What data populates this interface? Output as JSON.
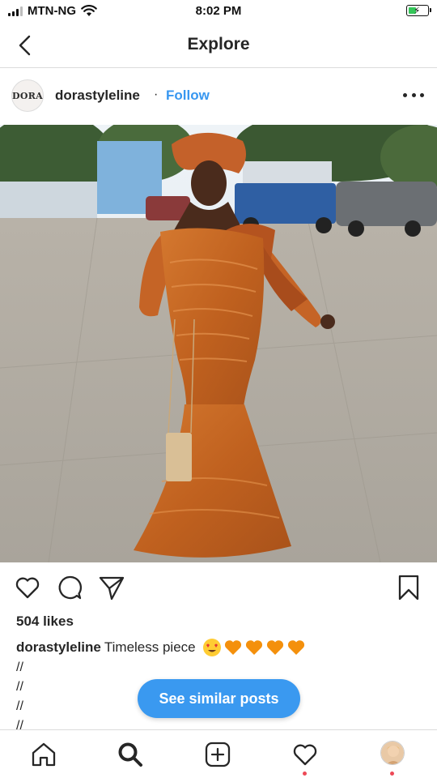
{
  "status_bar": {
    "carrier": "MTN-NG",
    "time": "8:02 PM"
  },
  "header": {
    "title": "Explore"
  },
  "post": {
    "avatar_text": "DORA",
    "username": "dorastyleline",
    "separator": "·",
    "follow_label": "Follow",
    "likes": "504 likes",
    "caption_user": "dorastyleline",
    "caption_text": "Timeless piece",
    "caption_lines": [
      "//",
      "//",
      "//",
      "//"
    ]
  },
  "similar_button": {
    "label": "See similar posts"
  },
  "colors": {
    "accent": "#3897f0",
    "button": "#3a99f0",
    "notification": "#ed4956",
    "dress": "#c8692a"
  },
  "icons": {
    "status": [
      "signal-icon",
      "wifi-icon",
      "battery-icon"
    ],
    "actions": [
      "heart-icon",
      "comment-icon",
      "share-icon",
      "bookmark-icon"
    ],
    "tabs": [
      "home-icon",
      "search-icon",
      "add-icon",
      "activity-icon",
      "profile-icon"
    ]
  }
}
